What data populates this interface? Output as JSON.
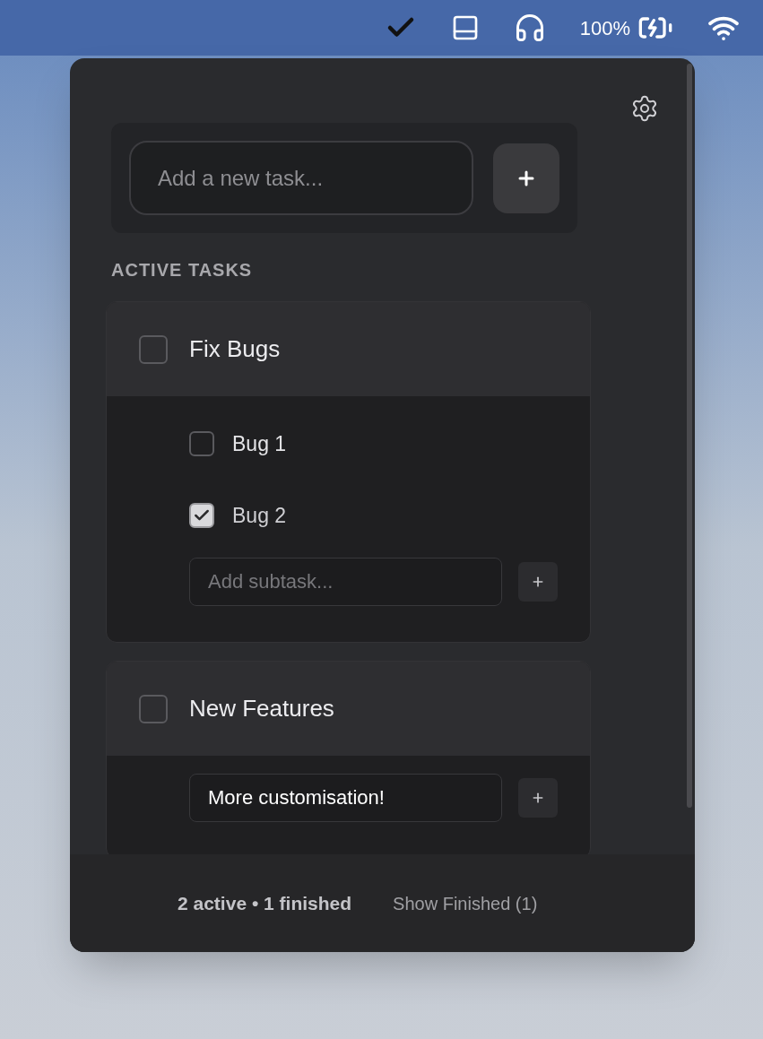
{
  "menu_bar": {
    "battery_percent": "100%"
  },
  "new_task": {
    "placeholder": "Add a new task..."
  },
  "section_title": "ACTIVE TASKS",
  "tasks": [
    {
      "title": "Fix Bugs",
      "checked": false,
      "subtasks": [
        {
          "title": "Bug 1",
          "checked": false
        },
        {
          "title": "Bug 2",
          "checked": true
        }
      ],
      "subtask_input": {
        "placeholder": "Add subtask..."
      }
    },
    {
      "title": "New Features",
      "checked": false,
      "subtask_input": {
        "value": "More customisation!"
      }
    }
  ],
  "footer": {
    "summary": "2 active • 1 finished",
    "show_finished": "Show Finished (1)"
  }
}
